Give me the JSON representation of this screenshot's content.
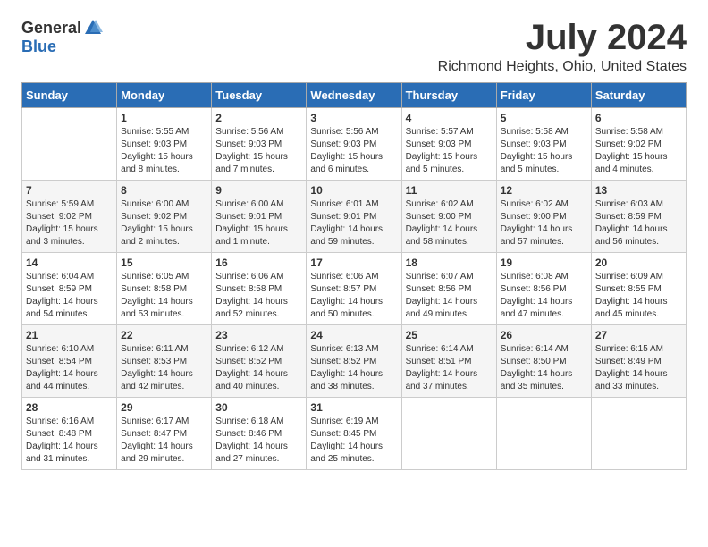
{
  "header": {
    "logo_general": "General",
    "logo_blue": "Blue",
    "month_title": "July 2024",
    "location": "Richmond Heights, Ohio, United States"
  },
  "days_of_week": [
    "Sunday",
    "Monday",
    "Tuesday",
    "Wednesday",
    "Thursday",
    "Friday",
    "Saturday"
  ],
  "weeks": [
    [
      {
        "day": "",
        "info": ""
      },
      {
        "day": "1",
        "info": "Sunrise: 5:55 AM\nSunset: 9:03 PM\nDaylight: 15 hours\nand 8 minutes."
      },
      {
        "day": "2",
        "info": "Sunrise: 5:56 AM\nSunset: 9:03 PM\nDaylight: 15 hours\nand 7 minutes."
      },
      {
        "day": "3",
        "info": "Sunrise: 5:56 AM\nSunset: 9:03 PM\nDaylight: 15 hours\nand 6 minutes."
      },
      {
        "day": "4",
        "info": "Sunrise: 5:57 AM\nSunset: 9:03 PM\nDaylight: 15 hours\nand 5 minutes."
      },
      {
        "day": "5",
        "info": "Sunrise: 5:58 AM\nSunset: 9:03 PM\nDaylight: 15 hours\nand 5 minutes."
      },
      {
        "day": "6",
        "info": "Sunrise: 5:58 AM\nSunset: 9:02 PM\nDaylight: 15 hours\nand 4 minutes."
      }
    ],
    [
      {
        "day": "7",
        "info": "Sunrise: 5:59 AM\nSunset: 9:02 PM\nDaylight: 15 hours\nand 3 minutes."
      },
      {
        "day": "8",
        "info": "Sunrise: 6:00 AM\nSunset: 9:02 PM\nDaylight: 15 hours\nand 2 minutes."
      },
      {
        "day": "9",
        "info": "Sunrise: 6:00 AM\nSunset: 9:01 PM\nDaylight: 15 hours\nand 1 minute."
      },
      {
        "day": "10",
        "info": "Sunrise: 6:01 AM\nSunset: 9:01 PM\nDaylight: 14 hours\nand 59 minutes."
      },
      {
        "day": "11",
        "info": "Sunrise: 6:02 AM\nSunset: 9:00 PM\nDaylight: 14 hours\nand 58 minutes."
      },
      {
        "day": "12",
        "info": "Sunrise: 6:02 AM\nSunset: 9:00 PM\nDaylight: 14 hours\nand 57 minutes."
      },
      {
        "day": "13",
        "info": "Sunrise: 6:03 AM\nSunset: 8:59 PM\nDaylight: 14 hours\nand 56 minutes."
      }
    ],
    [
      {
        "day": "14",
        "info": "Sunrise: 6:04 AM\nSunset: 8:59 PM\nDaylight: 14 hours\nand 54 minutes."
      },
      {
        "day": "15",
        "info": "Sunrise: 6:05 AM\nSunset: 8:58 PM\nDaylight: 14 hours\nand 53 minutes."
      },
      {
        "day": "16",
        "info": "Sunrise: 6:06 AM\nSunset: 8:58 PM\nDaylight: 14 hours\nand 52 minutes."
      },
      {
        "day": "17",
        "info": "Sunrise: 6:06 AM\nSunset: 8:57 PM\nDaylight: 14 hours\nand 50 minutes."
      },
      {
        "day": "18",
        "info": "Sunrise: 6:07 AM\nSunset: 8:56 PM\nDaylight: 14 hours\nand 49 minutes."
      },
      {
        "day": "19",
        "info": "Sunrise: 6:08 AM\nSunset: 8:56 PM\nDaylight: 14 hours\nand 47 minutes."
      },
      {
        "day": "20",
        "info": "Sunrise: 6:09 AM\nSunset: 8:55 PM\nDaylight: 14 hours\nand 45 minutes."
      }
    ],
    [
      {
        "day": "21",
        "info": "Sunrise: 6:10 AM\nSunset: 8:54 PM\nDaylight: 14 hours\nand 44 minutes."
      },
      {
        "day": "22",
        "info": "Sunrise: 6:11 AM\nSunset: 8:53 PM\nDaylight: 14 hours\nand 42 minutes."
      },
      {
        "day": "23",
        "info": "Sunrise: 6:12 AM\nSunset: 8:52 PM\nDaylight: 14 hours\nand 40 minutes."
      },
      {
        "day": "24",
        "info": "Sunrise: 6:13 AM\nSunset: 8:52 PM\nDaylight: 14 hours\nand 38 minutes."
      },
      {
        "day": "25",
        "info": "Sunrise: 6:14 AM\nSunset: 8:51 PM\nDaylight: 14 hours\nand 37 minutes."
      },
      {
        "day": "26",
        "info": "Sunrise: 6:14 AM\nSunset: 8:50 PM\nDaylight: 14 hours\nand 35 minutes."
      },
      {
        "day": "27",
        "info": "Sunrise: 6:15 AM\nSunset: 8:49 PM\nDaylight: 14 hours\nand 33 minutes."
      }
    ],
    [
      {
        "day": "28",
        "info": "Sunrise: 6:16 AM\nSunset: 8:48 PM\nDaylight: 14 hours\nand 31 minutes."
      },
      {
        "day": "29",
        "info": "Sunrise: 6:17 AM\nSunset: 8:47 PM\nDaylight: 14 hours\nand 29 minutes."
      },
      {
        "day": "30",
        "info": "Sunrise: 6:18 AM\nSunset: 8:46 PM\nDaylight: 14 hours\nand 27 minutes."
      },
      {
        "day": "31",
        "info": "Sunrise: 6:19 AM\nSunset: 8:45 PM\nDaylight: 14 hours\nand 25 minutes."
      },
      {
        "day": "",
        "info": ""
      },
      {
        "day": "",
        "info": ""
      },
      {
        "day": "",
        "info": ""
      }
    ]
  ]
}
